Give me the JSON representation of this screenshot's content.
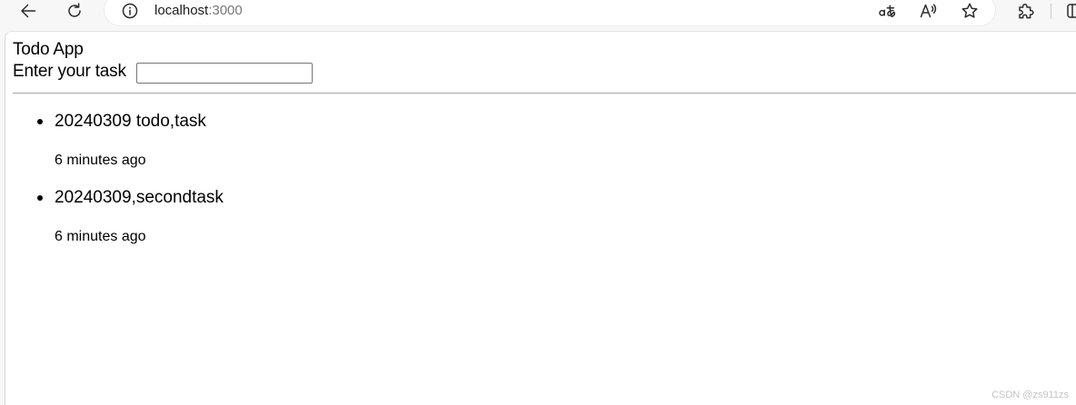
{
  "browser": {
    "address": {
      "host": "localhost",
      "port": ":3000"
    },
    "icons": {
      "back": "back-arrow-icon",
      "refresh": "refresh-icon",
      "site_info": "info-icon",
      "translate": "translate-icon",
      "read_aloud": "read-aloud-icon",
      "favorite": "star-icon",
      "extensions": "puzzle-icon",
      "split_screen": "split-screen-icon"
    },
    "colors": {
      "toolbar": "#f7f7f7",
      "address_bar": "#ffffff",
      "host_text": "#1b1b1b",
      "port_text": "#767676"
    }
  },
  "app": {
    "title": "Todo App",
    "input_label": "Enter your task",
    "input_value": ""
  },
  "todos": [
    {
      "text": "20240309 todo,task",
      "time": "6 minutes ago"
    },
    {
      "text": "20240309,secondtask",
      "time": "6 minutes ago"
    }
  ],
  "watermark": "CSDN @zs911zs"
}
